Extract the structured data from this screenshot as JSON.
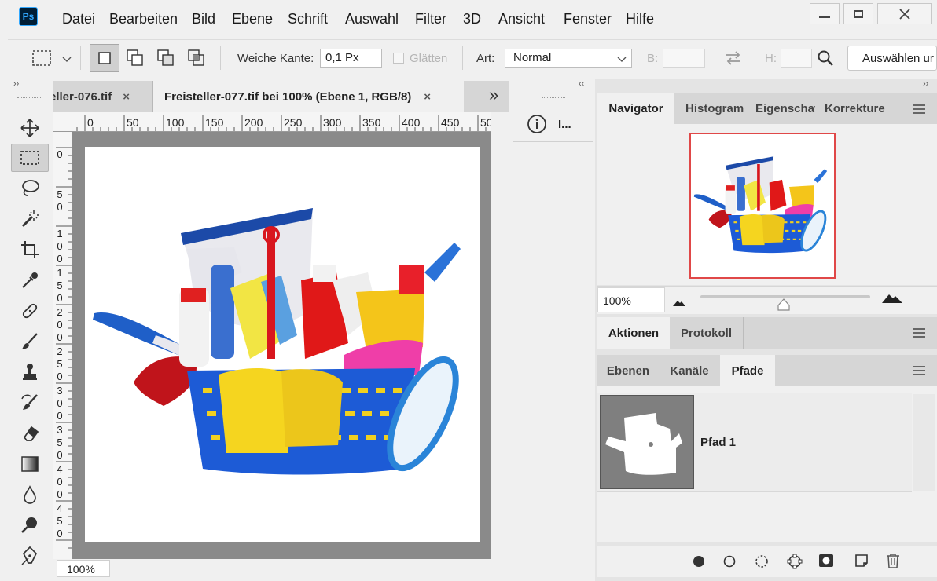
{
  "app": {
    "logo": "Ps"
  },
  "menu": [
    "Datei",
    "Bearbeiten",
    "Bild",
    "Ebene",
    "Schrift",
    "Auswahl",
    "Filter",
    "3D",
    "Ansicht",
    "Fenster",
    "Hilfe"
  ],
  "options": {
    "soft_edge_label": "Weiche Kante:",
    "soft_edge_value": "0,1 Px",
    "antialias_label": "Glätten",
    "style_label": "Art:",
    "style_value": "Normal",
    "width_label": "B:",
    "height_label": "H:",
    "select_mask_button": "Auswählen ur"
  },
  "tabs": [
    {
      "label": "eller-076.tif",
      "close": "×"
    },
    {
      "label": "Freisteller-077.tif bei 100% (Ebene 1, RGB/8)",
      "close": "×"
    }
  ],
  "tab_overflow": "»",
  "rulers": {
    "top": [
      "0",
      "50",
      "100",
      "150",
      "200",
      "250",
      "300",
      "350",
      "400",
      "450",
      "50"
    ],
    "left": [
      [
        "0"
      ],
      [
        "5",
        "0"
      ],
      [
        "1",
        "0",
        "0"
      ],
      [
        "1",
        "5",
        "0"
      ],
      [
        "2",
        "0",
        "0"
      ],
      [
        "2",
        "5",
        "0"
      ],
      [
        "3",
        "0",
        "0"
      ],
      [
        "3",
        "5",
        "0"
      ],
      [
        "4",
        "0",
        "0"
      ],
      [
        "4",
        "5",
        "0"
      ]
    ]
  },
  "status": {
    "zoom": "100%"
  },
  "mid_panel": {
    "info_label": "I..."
  },
  "navigator_panel": {
    "tabs": [
      "Navigator",
      "Histogram",
      "Eigenschaf",
      "Korrekture"
    ],
    "zoom": "100%"
  },
  "actions_panel": {
    "tabs": [
      "Aktionen",
      "Protokoll"
    ]
  },
  "layers_panel": {
    "tabs": [
      "Ebenen",
      "Kanäle",
      "Pfade"
    ],
    "paths": [
      {
        "name": "Pfad 1"
      }
    ]
  },
  "collapse_glyph": "‹‹",
  "expand_glyph": "››",
  "colors": {
    "accent": "#31a8ff",
    "selection_border": "#e04848"
  }
}
